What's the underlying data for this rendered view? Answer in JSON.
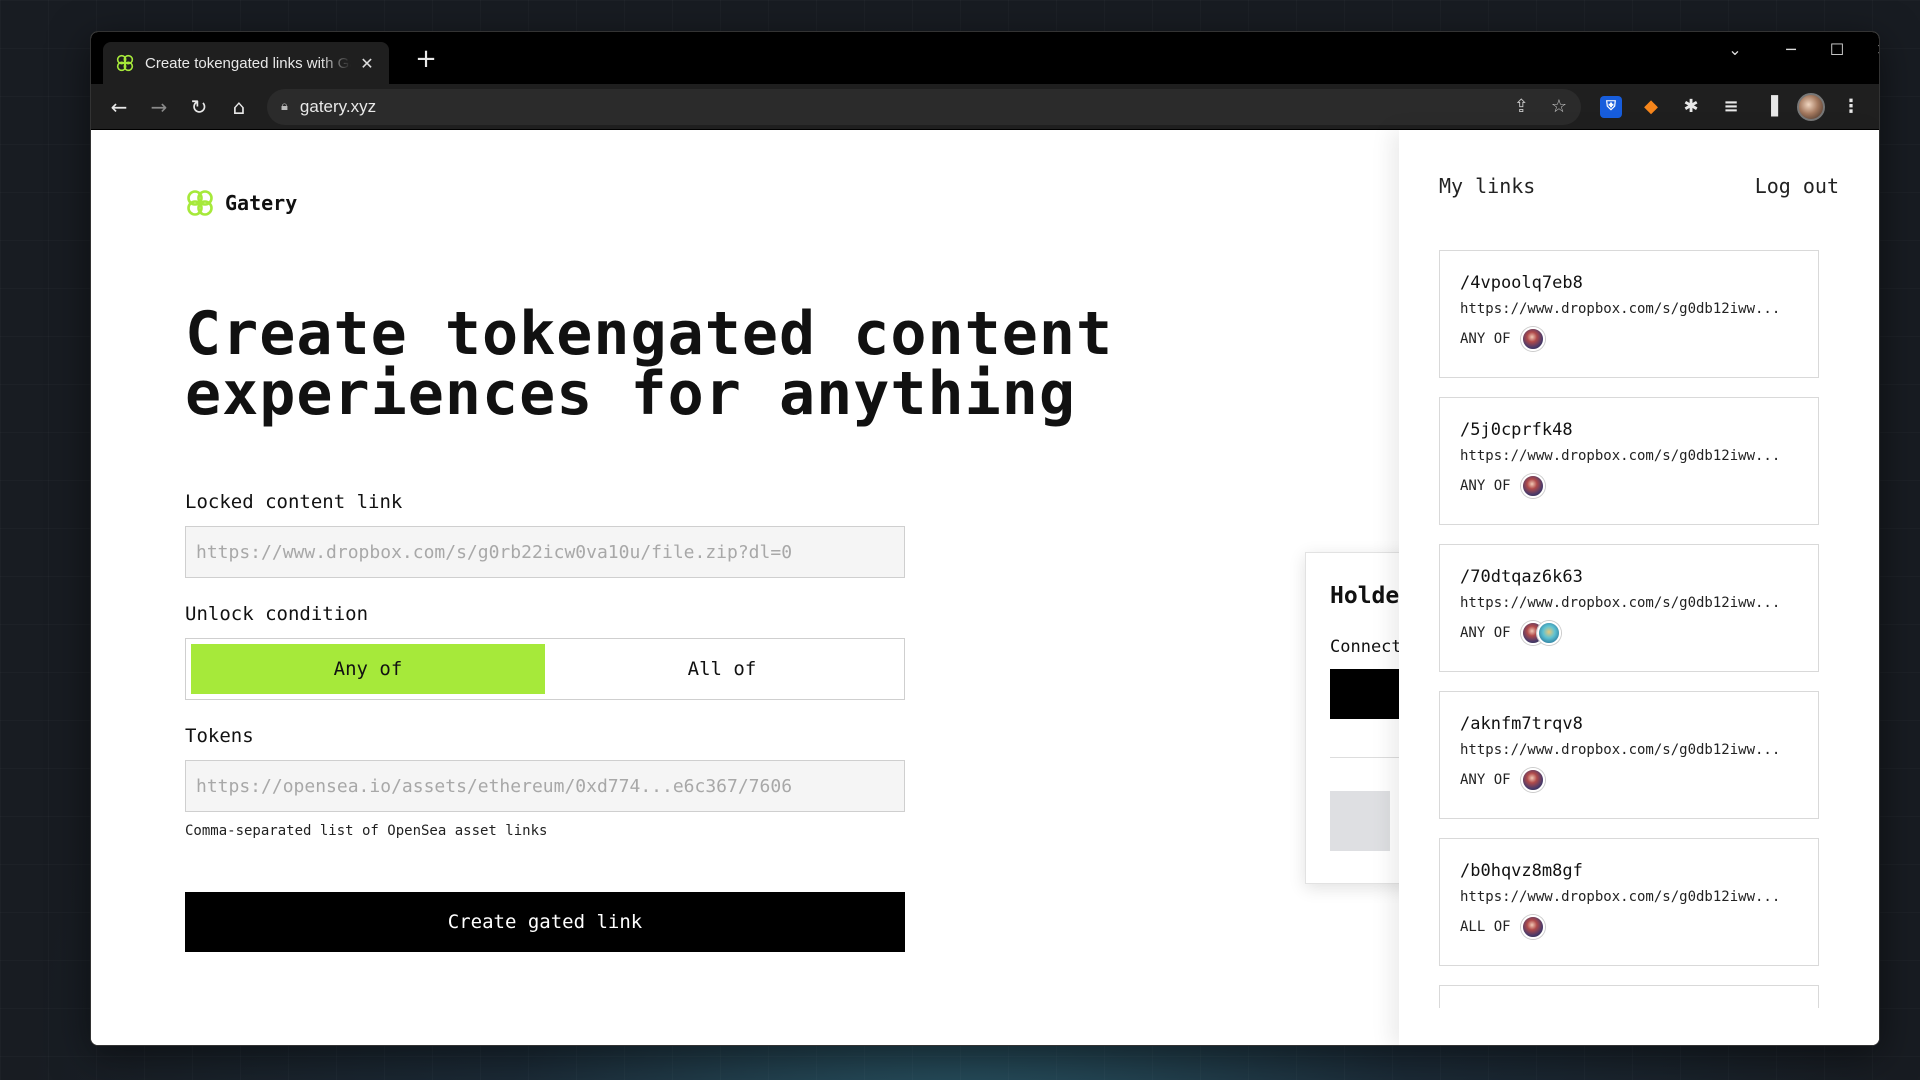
{
  "browser": {
    "tab_title": "Create tokengated links with Gatery",
    "tab_close": "✕",
    "new_tab": "+",
    "url": "gatery.xyz",
    "window_controls": [
      "⌄",
      "─",
      "☐",
      "✕"
    ],
    "brand_color": "#a6e93a"
  },
  "app": {
    "logo_text": "Gatery",
    "hero_line1": "Create tokengated content",
    "hero_line2": "experiences for anything",
    "locked_label": "Locked content link",
    "locked_placeholder": "https://www.dropbox.com/s/g0rb22icw0va10u/file.zip?dl=0",
    "unlock_label": "Unlock condition",
    "options": [
      "Any of",
      "All of"
    ],
    "selected_option": "Any of",
    "tokens_label": "Tokens",
    "tokens_placeholder": "https://opensea.io/assets/ethereum/0xd774...e6c367/7606",
    "tokens_helper": "Comma-separated list of OpenSea asset links",
    "submit": "Create gated link"
  },
  "modal": {
    "title": "Holde",
    "subtitle": "Connect"
  },
  "sidebar": {
    "my_links": "My links",
    "logout": "Log out",
    "links": [
      {
        "slug": "/4vpoolq7eb8",
        "url": "https://www.dropbox.com/s/g0db12iww...",
        "condition": "ANY OF",
        "tokens": 1
      },
      {
        "slug": "/5j0cprfk48",
        "url": "https://www.dropbox.com/s/g0db12iww...",
        "condition": "ANY OF",
        "tokens": 1
      },
      {
        "slug": "/70dtqaz6k63",
        "url": "https://www.dropbox.com/s/g0db12iww...",
        "condition": "ANY OF",
        "tokens": 2
      },
      {
        "slug": "/aknfm7trqv8",
        "url": "https://www.dropbox.com/s/g0db12iww...",
        "condition": "ANY OF",
        "tokens": 1
      },
      {
        "slug": "/b0hqvz8m8gf",
        "url": "https://www.dropbox.com/s/g0db12iww...",
        "condition": "ALL OF",
        "tokens": 1
      }
    ]
  }
}
